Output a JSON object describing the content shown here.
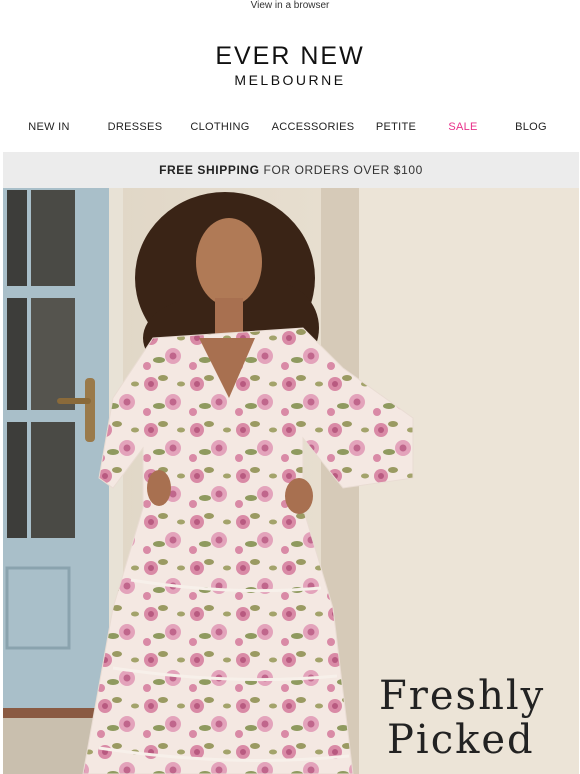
{
  "header": {
    "browser_link": "View in a browser"
  },
  "brand": {
    "name": "EVER NEW",
    "location": "MELBOURNE"
  },
  "nav": {
    "items": [
      {
        "label": "NEW IN"
      },
      {
        "label": "DRESSES"
      },
      {
        "label": "CLOTHING"
      },
      {
        "label": "ACCESSORIES"
      },
      {
        "label": "PETITE"
      },
      {
        "label": "SALE"
      },
      {
        "label": "BLOG"
      }
    ]
  },
  "banner": {
    "bold": "FREE SHIPPING",
    "rest": " FOR ORDERS OVER $100"
  },
  "hero": {
    "line1": "Freshly",
    "line2": "Picked"
  },
  "colors": {
    "sale": "#e8318a",
    "banner_bg": "#ececec",
    "wall": "#ece3d4",
    "door": "#a9bfc9"
  }
}
